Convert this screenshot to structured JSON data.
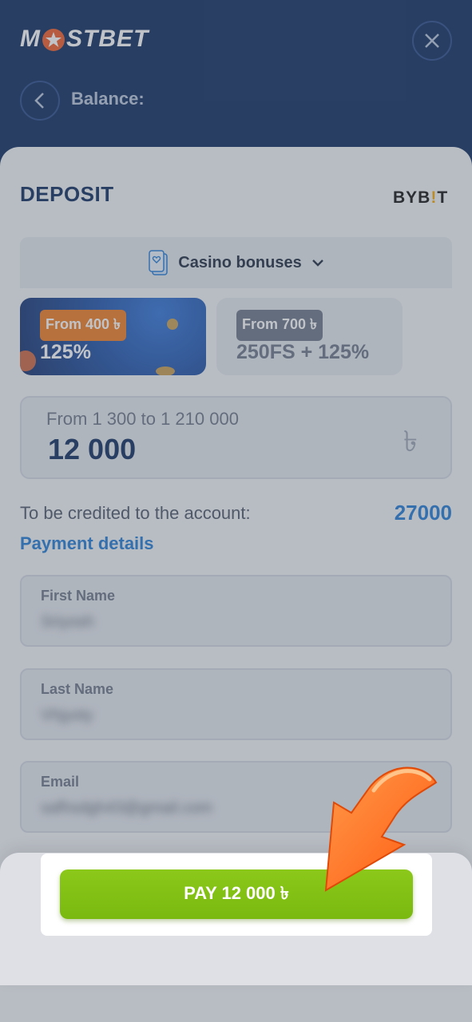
{
  "header": {
    "logo_text_left": "M",
    "logo_text_right": "STBET",
    "balance_label": "Balance:"
  },
  "deposit": {
    "title": "DEPOSIT",
    "provider_logo_left": "BYB",
    "provider_logo_mark": "!",
    "provider_logo_right": "T"
  },
  "bonus_selector": {
    "label": "Casino bonuses"
  },
  "bonus_cards": [
    {
      "tag": "From 400 ৳",
      "value": "125%",
      "selected": true
    },
    {
      "tag": "From 700 ৳",
      "value": "250FS + 125%",
      "selected": false
    }
  ],
  "amount": {
    "hint": "From 1 300 to 1 210 000",
    "value": "12 000",
    "currency_symbol": "৳"
  },
  "credit": {
    "label": "To be credited to the account:",
    "value": "27000"
  },
  "payment_details": {
    "heading": "Payment details",
    "first_name_label": "First Name",
    "first_name_value": "Sriyosh",
    "last_name_label": "Last Name",
    "last_name_value": "Vhjyoty",
    "email_label": "Email",
    "email_value": "safhsdgh43@gmail.com"
  },
  "pay_button": {
    "label": "PAY 12 000 ৳"
  },
  "colors": {
    "header_bg": "#0b2a5c",
    "accent_blue": "#1f7ad6",
    "pay_green": "#7ab910",
    "bonus_orange": "#f07b1f",
    "arrow_orange": "#ff6a1a"
  }
}
